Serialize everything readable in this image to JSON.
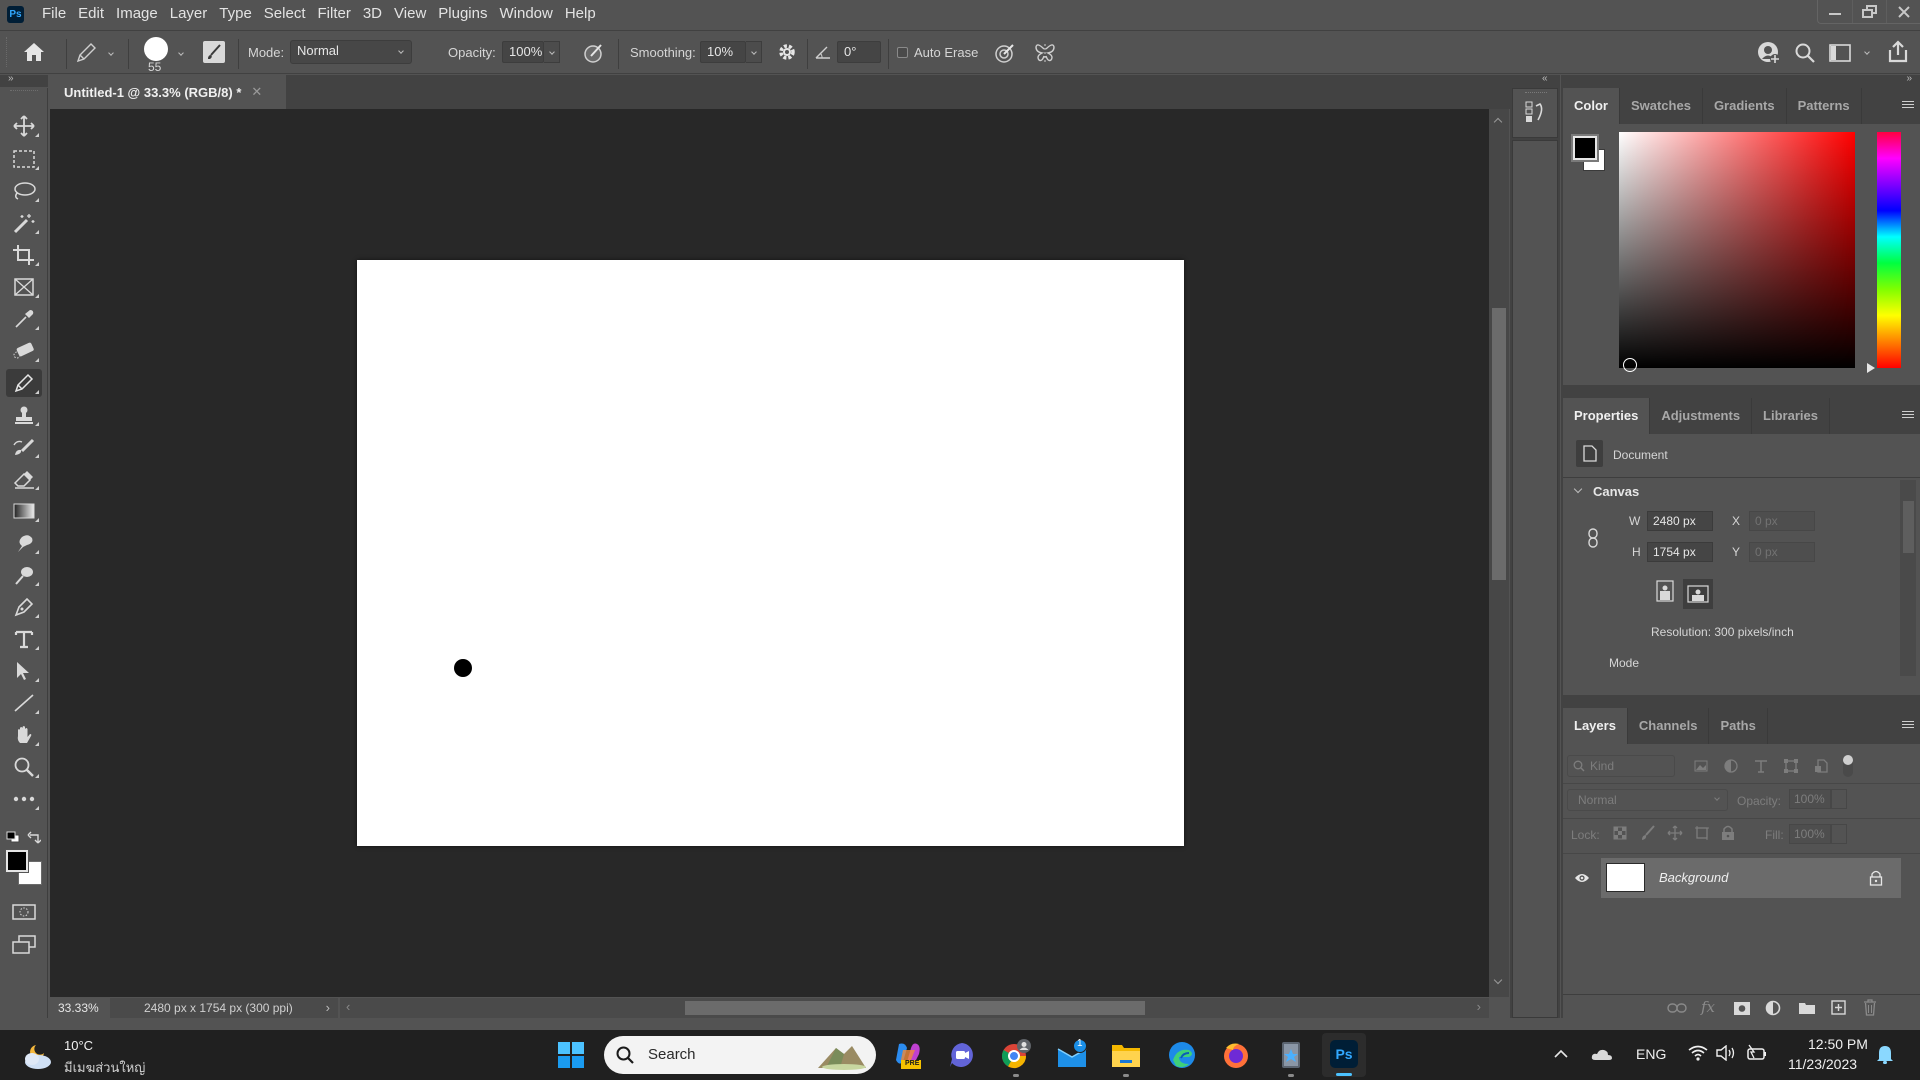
{
  "app": {
    "name": "Photoshop",
    "logo_text": "Ps",
    "menu": [
      "File",
      "Edit",
      "Image",
      "Layer",
      "Type",
      "Select",
      "Filter",
      "3D",
      "View",
      "Plugins",
      "Window",
      "Help"
    ]
  },
  "options_bar": {
    "brush_size": "55",
    "mode_label": "Mode:",
    "mode_value": "Normal",
    "opacity_label": "Opacity:",
    "opacity_value": "100%",
    "smoothing_label": "Smoothing:",
    "smoothing_value": "10%",
    "angle_value": "0°",
    "auto_erase_label": "Auto Erase",
    "auto_erase_checked": false
  },
  "document": {
    "tab_title": "Untitled-1 @ 33.3% (RGB/8) *",
    "zoom": "33.33%",
    "info": "2480 px x 1754 px (300 ppi)",
    "canvas_color": "#ffffff",
    "brush_dot": {
      "x_fraction": 0.128,
      "y_fraction": 0.696,
      "color": "#000000"
    }
  },
  "toolbar": {
    "tools": [
      "move",
      "rectangular-marquee",
      "lasso",
      "magic-wand",
      "crop",
      "frame",
      "eyedropper",
      "healing-brush",
      "pencil",
      "clone-stamp",
      "history-brush",
      "eraser",
      "gradient",
      "smudge",
      "dodge",
      "pen",
      "type",
      "path-selection",
      "line",
      "hand",
      "zoom",
      "more"
    ],
    "active_tool": "pencil",
    "foreground_color": "#000000",
    "background_color": "#ffffff"
  },
  "color_panel": {
    "tabs": [
      "Color",
      "Swatches",
      "Gradients",
      "Patterns"
    ],
    "active_tab": "Color",
    "hue": "#ff0000"
  },
  "properties_panel": {
    "tabs": [
      "Properties",
      "Adjustments",
      "Libraries"
    ],
    "active_tab": "Properties",
    "document_label": "Document",
    "section_label": "Canvas",
    "w_label": "W",
    "w_value": "2480 px",
    "h_label": "H",
    "h_value": "1754 px",
    "x_label": "X",
    "x_value": "0 px",
    "y_label": "Y",
    "y_value": "0 px",
    "resolution": "Resolution: 300 pixels/inch",
    "mode_label": "Mode"
  },
  "layers_panel": {
    "tabs": [
      "Layers",
      "Channels",
      "Paths"
    ],
    "active_tab": "Layers",
    "filter_placeholder": "Kind",
    "blend_mode": "Normal",
    "opacity_label": "Opacity:",
    "opacity_value": "100%",
    "lock_label": "Lock:",
    "fill_label": "Fill:",
    "fill_value": "100%",
    "layers": [
      {
        "name": "Background",
        "visible": true,
        "locked": true
      }
    ]
  },
  "taskbar": {
    "weather_temp": "10°C",
    "weather_desc": "มีเมฆส่วนใหญ่",
    "search_label": "Search",
    "mail_badge": "1",
    "language": "ENG",
    "time": "12:50 PM",
    "date": "11/23/2023",
    "copilot_badge": "PRE"
  }
}
